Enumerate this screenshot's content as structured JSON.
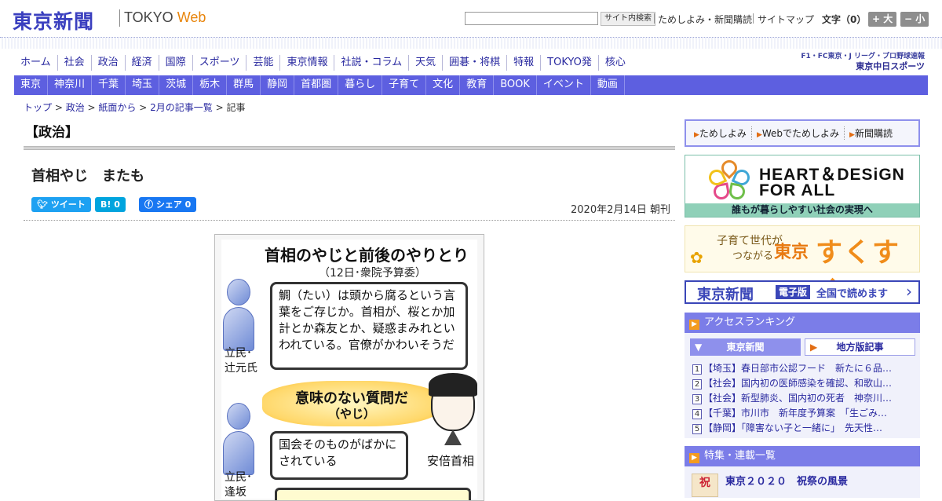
{
  "header": {
    "logo_jp": "東京新聞",
    "logo_tokyo": "TOKYO",
    "logo_web": "Web",
    "search_placeholder": "",
    "search_button": "サイト内検索",
    "link_trial": "ためしよみ・新聞購読",
    "link_sitemap": "サイトマップ",
    "font_label": "文字（0）",
    "font_larger": "+ 大",
    "font_smaller": "− 小"
  },
  "nav_main": [
    "ホーム",
    "社会",
    "政治",
    "経済",
    "国際",
    "スポーツ",
    "芸能",
    "東京情報",
    "社説・コラム",
    "天気",
    "囲碁・将棋",
    "特報",
    "TOKYO発",
    "核心"
  ],
  "sports_logo": {
    "line1": "F1・FC東京・J リーグ・プロ野球速報",
    "line2": "東京中日スポーツ"
  },
  "nav_region": [
    "東京",
    "神奈川",
    "千葉",
    "埼玉",
    "茨城",
    "栃木",
    "群馬",
    "静岡",
    "首都圏",
    "暮らし",
    "子育て",
    "文化",
    "教育",
    "BOOK",
    "イベント",
    "動画"
  ],
  "breadcrumb": {
    "items": [
      "トップ",
      "政治",
      "紙面から",
      "2月の記事一覧"
    ],
    "sep": " > ",
    "current": "記事"
  },
  "article": {
    "section": "【政治】",
    "headline": "首相やじ　またも",
    "tweet": "ツイート",
    "hatena": "B! 0",
    "share": "シェア 0",
    "date": "2020年2月14日 朝刊"
  },
  "figure": {
    "title": "首相のやじと前後のやりとり",
    "subtitle": "（12日･衆院予算委）",
    "speaker1": "立民･\n辻元氏",
    "quote1": "鯛（たい）は頭から腐るという言葉をご存じか。首相が、桜とか加計とか森友とか、疑惑まみれといわれている。官僚がかわいそうだ",
    "yaji_line1": "意味のない質問だ",
    "yaji_line2": "（やじ）",
    "abe_label": "安倍首相",
    "quote2": "国会そのものがばかにされている",
    "speaker2": "立民･\n逢坂"
  },
  "sidebar": {
    "sub_links": [
      "ためしよみ",
      "Webでためしよみ",
      "新聞購読"
    ],
    "hd_title1": "HEART＆DESiGN",
    "hd_title2": "FOR ALL",
    "hd_caption": "誰もが暮らしやすい社会の実現へ",
    "suku_small1": "子育て世代が",
    "suku_small2": "つながる",
    "suku_tokyo": "東京",
    "suku_main": "すくすく",
    "e_logo": "東京新聞",
    "e_badge": "電子版",
    "e_text": "全国で読めます",
    "ranking_head": "アクセスランキング",
    "rank_tab1": "東京新聞",
    "rank_tab2": "地方版記事",
    "ranking": [
      {
        "n": "1",
        "text": "【埼玉】春日部市公認フード　新たに６品…"
      },
      {
        "n": "2",
        "text": "【社会】国内初の医師感染を確認、和歌山…"
      },
      {
        "n": "3",
        "text": "【社会】新型肺炎、国内初の死者　神奈川…"
      },
      {
        "n": "4",
        "text": "【千葉】市川市　新年度予算案　「生ごみ…"
      },
      {
        "n": "5",
        "text": "【静岡】「障害ない子と一緒に」　先天性…"
      }
    ],
    "feature_head": "特集・連載一覧",
    "feature_title": "東京２０２０　祝祭の風景",
    "feature_img_text": "祝"
  },
  "colors": {
    "brand": "#3a3fbf",
    "nav_blue": "#5d5fe0",
    "sidebar_head": "#7b7de8",
    "accent_orange": "#f39b1f",
    "twitter": "#1da1f2",
    "hatena": "#00a4de",
    "facebook": "#1877f2"
  }
}
